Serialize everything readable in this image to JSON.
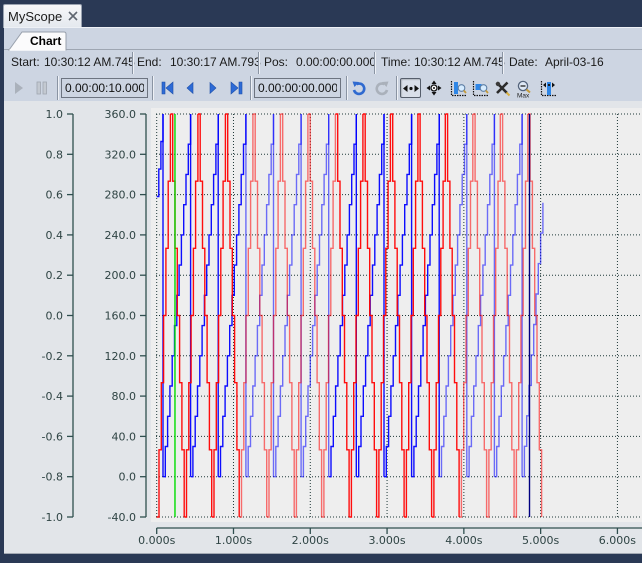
{
  "window": {
    "tab_title": "MyScope",
    "close_icon": "close-icon"
  },
  "tabs": [
    {
      "label": "Chart",
      "active": true
    }
  ],
  "status": {
    "items": [
      {
        "label": "Start:",
        "value": "10:30:12 AM.745"
      },
      {
        "label": "End:",
        "value": "10:30:17 AM.793"
      },
      {
        "label": "Pos:",
        "value": "0.00:00:00.000"
      },
      {
        "label": "Time:",
        "value": "10:30:12 AM.745"
      },
      {
        "label": "Date:",
        "value": "April-03-16"
      }
    ]
  },
  "toolbar": {
    "duration_field": "0.00:00:10.000",
    "position_field": "0.00:00:00.000",
    "buttons": [
      {
        "icon": "play-icon",
        "state": "disabled"
      },
      {
        "icon": "pause-icon",
        "state": "disabled"
      },
      {
        "icon": "skip-to-start-icon",
        "state": "enabled"
      },
      {
        "icon": "step-back-icon",
        "state": "enabled"
      },
      {
        "icon": "step-forward-icon",
        "state": "enabled"
      },
      {
        "icon": "skip-to-end-icon",
        "state": "enabled"
      },
      {
        "icon": "undo-icon",
        "state": "enabled"
      },
      {
        "icon": "redo-icon",
        "state": "disabled"
      },
      {
        "icon": "pan-x-icon",
        "state": "pressed"
      },
      {
        "icon": "move-icon",
        "state": "enabled"
      },
      {
        "icon": "zoom-x-icon",
        "state": "enabled"
      },
      {
        "icon": "zoom-xy-icon",
        "state": "enabled"
      },
      {
        "icon": "no-zoom-icon",
        "state": "enabled"
      },
      {
        "icon": "zoom-max-icon",
        "state": "enabled"
      },
      {
        "icon": "fit-view-icon",
        "state": "enabled"
      }
    ]
  },
  "chart_data": {
    "type": "line",
    "title": "",
    "xlabel": "",
    "ylabel": "",
    "grid": true,
    "legend": "none",
    "x_axis": {
      "min": 0,
      "max": 6.32,
      "ticks": [
        0,
        1,
        2,
        3,
        4,
        5,
        6
      ],
      "tick_labels": [
        "0.000s",
        "1.000s",
        "2.000s",
        "3.000s",
        "4.000s",
        "5.000s",
        "6.000s"
      ]
    },
    "y_axes": [
      {
        "min": -1,
        "max": 1,
        "ticks": [
          1.0,
          0.8,
          0.6,
          0.4,
          0.2,
          0.0,
          -0.2,
          -0.4,
          -0.6,
          -0.8,
          -1.0
        ],
        "tick_labels": [
          "1.0",
          "0.8",
          "0.6",
          "0.4",
          "0.2",
          "0.0",
          "-0.2",
          "-0.4",
          "-0.6",
          "-0.8",
          "-1.0"
        ]
      },
      {
        "min": -40,
        "max": 360,
        "ticks": [
          360,
          320,
          280,
          240,
          200,
          160,
          120,
          80,
          40,
          0,
          -40
        ],
        "tick_labels": [
          "360.0",
          "320.0",
          "280.0",
          "240.0",
          "200.0",
          "160.0",
          "120.0",
          "80.0",
          "40.0",
          "0.0",
          "-40.0"
        ]
      }
    ],
    "series": [
      {
        "color": "#0000ff",
        "y_axis": 1,
        "shape": "sawtooth",
        "points": [
          [
            0,
            278
          ],
          [
            0.082,
            360
          ],
          [
            0.082,
            0
          ],
          [
            0.442,
            360
          ],
          [
            0.442,
            0
          ],
          [
            0.801,
            360
          ],
          [
            0.801,
            0
          ],
          [
            1.161,
            360
          ],
          [
            1.161,
            0
          ],
          [
            1.521,
            360
          ],
          [
            1.521,
            0
          ],
          [
            1.881,
            360
          ],
          [
            1.881,
            0
          ],
          [
            2.24,
            360
          ],
          [
            2.24,
            0
          ],
          [
            2.6,
            360
          ],
          [
            2.6,
            0
          ],
          [
            2.96,
            360
          ],
          [
            2.96,
            0
          ],
          [
            3.319,
            360
          ],
          [
            3.319,
            0
          ],
          [
            3.679,
            360
          ],
          [
            3.679,
            0
          ],
          [
            4.039,
            360
          ],
          [
            4.039,
            0
          ],
          [
            4.398,
            360
          ],
          [
            4.398,
            0
          ],
          [
            4.758,
            360
          ],
          [
            4.758,
            0
          ],
          [
            5.03,
            272
          ]
        ]
      },
      {
        "color": "#ff0000",
        "y_axis": 1,
        "shape": "triangle",
        "points": [
          [
            0,
            -40
          ],
          [
            0.179,
            360
          ],
          [
            0.358,
            -40
          ],
          [
            0.537,
            360
          ],
          [
            0.716,
            -40
          ],
          [
            0.895,
            360
          ],
          [
            1.074,
            -40
          ],
          [
            1.253,
            360
          ],
          [
            1.432,
            -40
          ],
          [
            1.611,
            360
          ],
          [
            1.79,
            -40
          ],
          [
            1.969,
            360
          ],
          [
            2.148,
            -40
          ],
          [
            2.327,
            360
          ],
          [
            2.506,
            -40
          ],
          [
            2.685,
            360
          ],
          [
            2.864,
            -40
          ],
          [
            3.043,
            360
          ],
          [
            3.222,
            -40
          ],
          [
            3.401,
            360
          ],
          [
            3.58,
            -40
          ],
          [
            3.759,
            360
          ],
          [
            3.938,
            -40
          ],
          [
            4.117,
            360
          ],
          [
            4.296,
            -40
          ],
          [
            4.475,
            360
          ],
          [
            4.654,
            -40
          ],
          [
            4.833,
            360
          ],
          [
            5.012,
            -40
          ]
        ]
      }
    ],
    "cursors": [
      {
        "color": "#00dd00",
        "x": 0.238
      },
      {
        "color": "#000080",
        "x": 4.855
      }
    ]
  }
}
